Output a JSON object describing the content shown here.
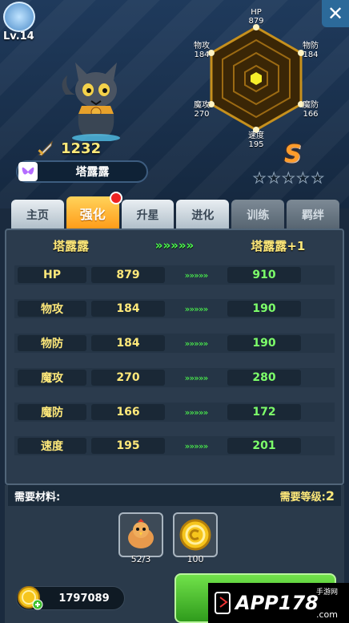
{
  "header": {
    "level": "Lv.14",
    "close_symbol": "✕"
  },
  "pet": {
    "power": "1232",
    "name": "塔露露",
    "grade": "S",
    "stars": 5
  },
  "radar": {
    "stats": [
      {
        "label": "HP",
        "value": "879"
      },
      {
        "label": "物防",
        "value": "184"
      },
      {
        "label": "魔防",
        "value": "166"
      },
      {
        "label": "速度",
        "value": "195"
      },
      {
        "label": "魔攻",
        "value": "270"
      },
      {
        "label": "物攻",
        "value": "184"
      }
    ]
  },
  "tabs": [
    {
      "label": "主页",
      "state": "normal"
    },
    {
      "label": "强化",
      "state": "active",
      "badge": true
    },
    {
      "label": "升星",
      "state": "normal"
    },
    {
      "label": "进化",
      "state": "normal"
    },
    {
      "label": "训练",
      "state": "disabled"
    },
    {
      "label": "羁绊",
      "state": "disabled"
    }
  ],
  "upgrade": {
    "from_name": "塔露露",
    "arrow": "»»»»»",
    "to_name": "塔露露+1",
    "rows": [
      {
        "stat": "HP",
        "from": "879",
        "to": "910"
      },
      {
        "stat": "物攻",
        "from": "184",
        "to": "190"
      },
      {
        "stat": "物防",
        "from": "184",
        "to": "190"
      },
      {
        "stat": "魔攻",
        "from": "270",
        "to": "280"
      },
      {
        "stat": "魔防",
        "from": "166",
        "to": "172"
      },
      {
        "stat": "速度",
        "from": "195",
        "to": "201"
      }
    ]
  },
  "materials": {
    "label": "需要材料:",
    "level_label": "需要等级:",
    "level_value": "2",
    "items": [
      {
        "icon": "chicken-icon",
        "count": "52/3"
      },
      {
        "icon": "gold-coin-icon",
        "count": "100"
      }
    ]
  },
  "wallet": {
    "coins": "1797089",
    "icon": "gold-coin-icon"
  },
  "watermark": {
    "brand": "APP178",
    "sub": "手游网",
    "domain": ".com"
  }
}
